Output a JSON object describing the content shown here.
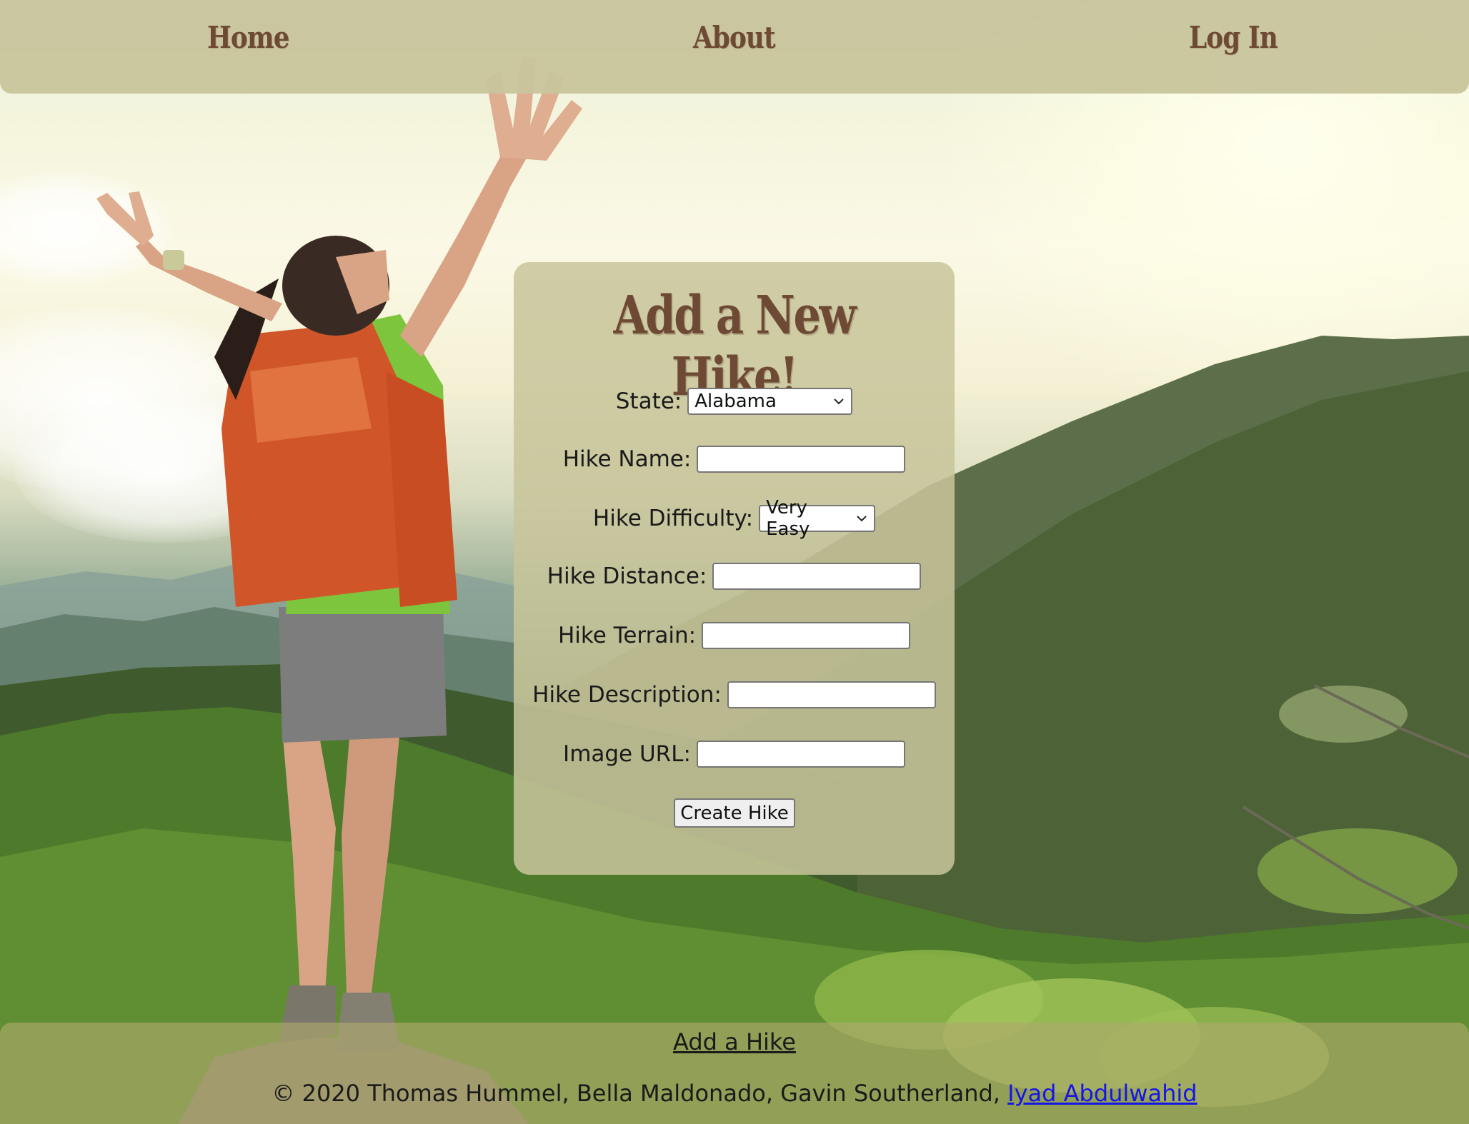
{
  "nav": {
    "home": "Home",
    "about": "About",
    "login": "Log In"
  },
  "form": {
    "title": "Add a New Hike!",
    "state_label": "State:",
    "state_value": "Alabama",
    "name_label": "Hike Name:",
    "difficulty_label": "Hike Difficulty:",
    "difficulty_value": "Very Easy",
    "distance_label": "Hike Distance:",
    "terrain_label": "Hike Terrain:",
    "description_label": "Hike Description:",
    "image_label": "Image URL:",
    "submit_label": "Create Hike"
  },
  "footer": {
    "add_link": "Add a Hike",
    "copyright": "© 2020 Thomas Hummel, Bella Maldonado, Gavin Southerland, ",
    "author_link": "Iyad Abdulwahid"
  },
  "icons": {
    "select_arrow": "chevron-down-icon"
  }
}
